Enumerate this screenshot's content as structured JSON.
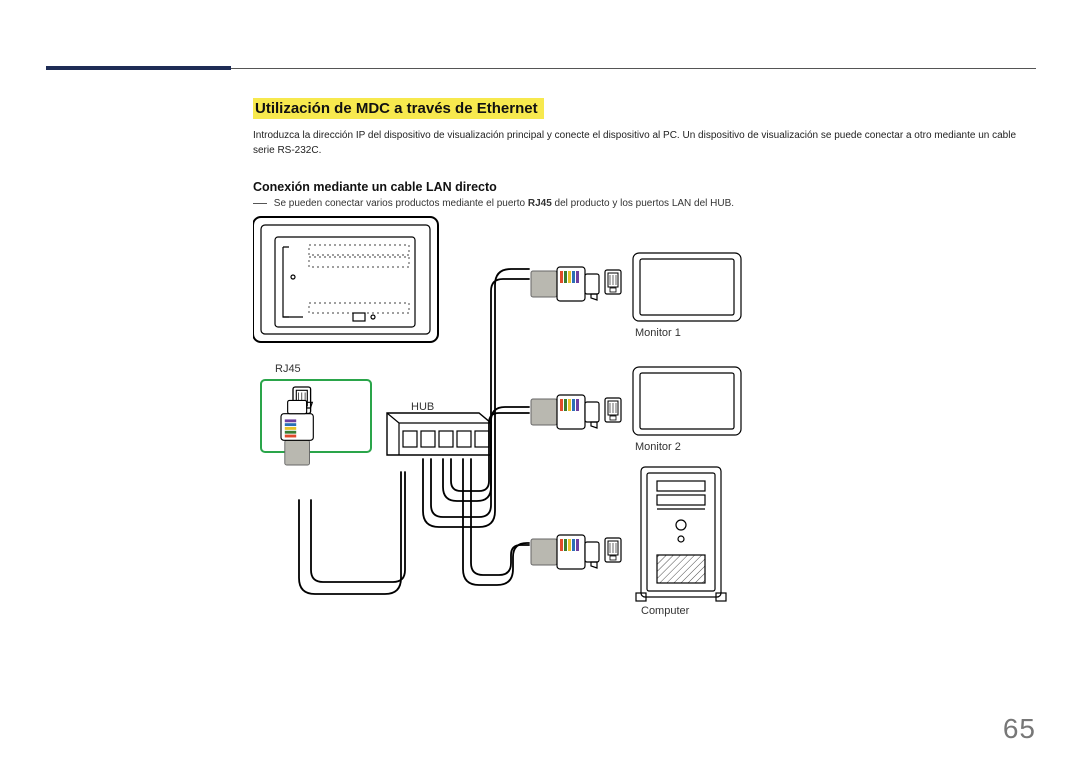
{
  "page_number": "65",
  "heading": "Utilización de MDC a través de Ethernet",
  "intro": "Introduzca la dirección IP del dispositivo de visualización principal y conecte el dispositivo al PC. Un dispositivo de visualización se puede conectar a otro mediante un cable serie RS-232C.",
  "subheading": "Conexión mediante un cable LAN directo",
  "note_pre": "Se pueden conectar varios productos mediante el puerto ",
  "note_bold": "RJ45",
  "note_post": " del producto y los puertos LAN del HUB.",
  "labels": {
    "rj45": "RJ45",
    "hub": "HUB",
    "monitor1": "Monitor 1",
    "monitor2": "Monitor 2",
    "computer": "Computer"
  }
}
